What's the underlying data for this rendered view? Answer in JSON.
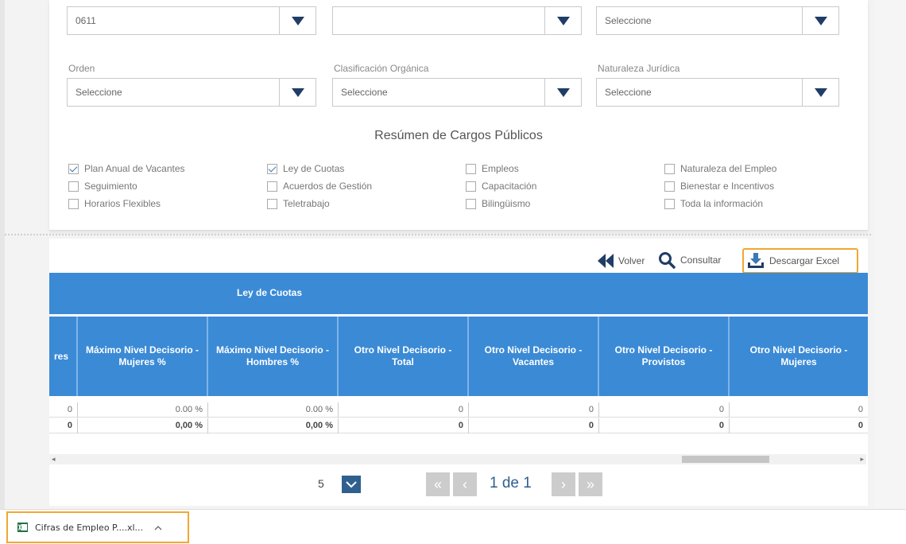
{
  "filters_row1": [
    {
      "value": "0611"
    },
    {
      "value": ""
    },
    {
      "value": "Seleccione"
    }
  ],
  "filters_row2": [
    {
      "label": "Orden",
      "value": "Seleccione"
    },
    {
      "label": "Clasificación Orgánica",
      "value": "Seleccione"
    },
    {
      "label": "Naturaleza Jurídica",
      "value": "Seleccione"
    }
  ],
  "section_title": "Resúmen de Cargos Públicos",
  "checkboxes": [
    {
      "label": "Plan Anual de Vacantes",
      "checked": true
    },
    {
      "label": "Seguimiento",
      "checked": false
    },
    {
      "label": "Horarios Flexibles",
      "checked": false
    },
    {
      "label": "Ley de Cuotas",
      "checked": true
    },
    {
      "label": "Acuerdos de Gestión",
      "checked": false
    },
    {
      "label": "Teletrabajo",
      "checked": false
    },
    {
      "label": "Empleos",
      "checked": false
    },
    {
      "label": "Capacitación",
      "checked": false
    },
    {
      "label": "Bilingüismo",
      "checked": false
    },
    {
      "label": "Naturaleza del Empleo",
      "checked": false
    },
    {
      "label": "Bienestar e Incentivos",
      "checked": false
    },
    {
      "label": "Toda la información",
      "checked": false
    }
  ],
  "actions": {
    "back": "Volver",
    "query": "Consultar",
    "download": "Descargar Excel"
  },
  "grid": {
    "group_header": "Ley de Cuotas",
    "columns": [
      "res",
      "Máximo Nivel Decisorio - Mujeres %",
      "Máximo Nivel Decisorio - Hombres %",
      "Otro Nivel Decisorio - Total",
      "Otro Nivel Decisorio - Vacantes",
      "Otro Nivel Decisorio - Provistos",
      "Otro Nivel Decisorio - Mujeres"
    ],
    "rows": [
      [
        "0",
        "0.00 %",
        "0.00 %",
        "0",
        "0",
        "0",
        "0"
      ],
      [
        "0",
        "0,00 %",
        "0,00 %",
        "0",
        "0",
        "0",
        "0"
      ]
    ]
  },
  "pager": {
    "page_size": "5",
    "page_info": "1 de 1"
  },
  "download_bar": {
    "file_name": "Cifras de Empleo P....xl..."
  }
}
